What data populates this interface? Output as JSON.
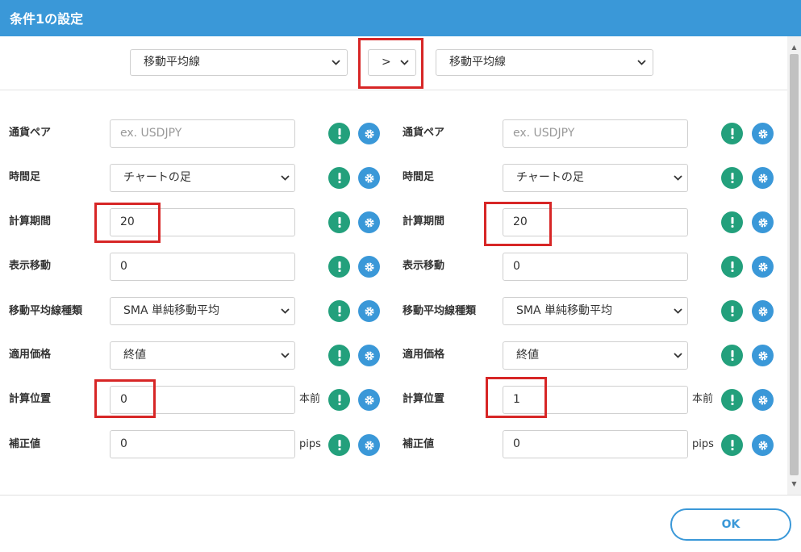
{
  "header": {
    "title": "条件1の設定"
  },
  "compare": {
    "left_indicator": "移動平均線",
    "operator": ">",
    "right_indicator": "移動平均線"
  },
  "left": {
    "currency_pair": {
      "label": "通貨ペア",
      "placeholder": "ex. USDJPY"
    },
    "timeframe": {
      "label": "時間足",
      "value": "チャートの足"
    },
    "period": {
      "label": "計算期間",
      "value": "20"
    },
    "shift": {
      "label": "表示移動",
      "value": "0"
    },
    "ma_type": {
      "label": "移動平均線種類",
      "value": "SMA 単純移動平均"
    },
    "price": {
      "label": "適用価格",
      "value": "終値"
    },
    "position": {
      "label": "計算位置",
      "value": "0",
      "unit": "本前"
    },
    "offset": {
      "label": "補正値",
      "value": "0",
      "unit": "pips"
    }
  },
  "right": {
    "currency_pair": {
      "label": "通貨ペア",
      "placeholder": "ex. USDJPY"
    },
    "timeframe": {
      "label": "時間足",
      "value": "チャートの足"
    },
    "period": {
      "label": "計算期間",
      "value": "20"
    },
    "shift": {
      "label": "表示移動",
      "value": "0"
    },
    "ma_type": {
      "label": "移動平均線種類",
      "value": "SMA 単純移動平均"
    },
    "price": {
      "label": "適用価格",
      "value": "終値"
    },
    "position": {
      "label": "計算位置",
      "value": "1",
      "unit": "本前"
    },
    "offset": {
      "label": "補正値",
      "value": "0",
      "unit": "pips"
    }
  },
  "footer": {
    "ok_label": "OK"
  },
  "icons": {
    "info": "exclamation-icon",
    "settings": "gear-icon",
    "dropdown": "chevron-down-icon"
  },
  "colors": {
    "header": "#3a98d8",
    "info_button": "#23a07c",
    "settings_button": "#3a98d8",
    "highlight": "#d72626"
  }
}
